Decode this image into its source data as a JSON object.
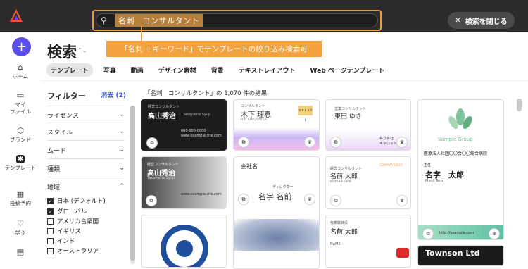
{
  "topbar": {
    "search_query": "名刺　コンサルタント",
    "close_label": "検索を閉じる"
  },
  "callout": "「名刺 ＋キーワード」でテンプレートの絞り込み検索可",
  "rail": {
    "items": [
      {
        "label": "ホーム",
        "icon": "home-icon"
      },
      {
        "label": "マイ\nファイル",
        "icon": "folder-icon"
      },
      {
        "label": "ブランド",
        "icon": "brand-icon"
      },
      {
        "label": "テンプレート",
        "icon": "template-icon"
      },
      {
        "label": "投稿予約",
        "icon": "calendar-icon"
      },
      {
        "label": "学ぶ",
        "icon": "bulb-icon"
      }
    ]
  },
  "page": {
    "title": "検索"
  },
  "tabs": [
    "テンプレート",
    "写真",
    "動画",
    "デザイン素材",
    "背景",
    "テキストレイアウト",
    "Web ページテンプレート"
  ],
  "filters": {
    "title": "フィルター",
    "clear": "消去 (2)",
    "sections": [
      "ライセンス",
      "スタイル",
      "ムード",
      "種類",
      "地域"
    ],
    "regions": [
      {
        "label": "日本 (デフォルト)",
        "checked": true
      },
      {
        "label": "グローバル",
        "checked": true
      },
      {
        "label": "アメリカ合衆国",
        "checked": false
      },
      {
        "label": "イギリス",
        "checked": false
      },
      {
        "label": "インド",
        "checked": false
      },
      {
        "label": "オーストラリア",
        "checked": false
      }
    ]
  },
  "results": {
    "summary": "「名刺　コンサルタント」の 1,070 件の結果"
  },
  "cards": {
    "c1": {
      "role": "経営コンサルタント",
      "name": "高山秀治",
      "roman": "Takayama Syuji",
      "phone": "000-000-0000",
      "url": "www.example.site.com"
    },
    "c2": {
      "role": "コンサルタント",
      "name": "木下 理恵",
      "roman": "RIE KINOSHITA",
      "tag": "ＣＲＥＡＴＥ"
    },
    "c3": {
      "role": "営業コンサルタント",
      "name": "東田 ゆき",
      "company": "株式会社\nキャロット"
    },
    "c4": {
      "name": "名字　太郎",
      "org": "医療法人社団〇〇会〇〇総合病院",
      "role": "主任",
      "roman": "Myoji Taro",
      "sample": "Sample Group",
      "url": "http://example.com"
    },
    "c5": {
      "role": "経営コンサルタント",
      "name": "高山秀治",
      "roman": "Takayama Syuji",
      "url": "www.example.site.com"
    },
    "c6": {
      "company": "会社名",
      "role": "ディレクター",
      "name": "名字 名前"
    },
    "c7": {
      "role": "経営コンサルタント",
      "name": "名前 太郎",
      "roman": "Namae Taro",
      "tag": "COMPANY LOGO"
    },
    "c8": {
      "role": "代表取締役",
      "name": "名前 太郎",
      "company": "NAME"
    },
    "c9": {
      "name": "Townson Ltd"
    }
  },
  "colors": {
    "accent": "#f3a23f",
    "brand": "#5a4ee6",
    "link": "#3b59d9"
  }
}
